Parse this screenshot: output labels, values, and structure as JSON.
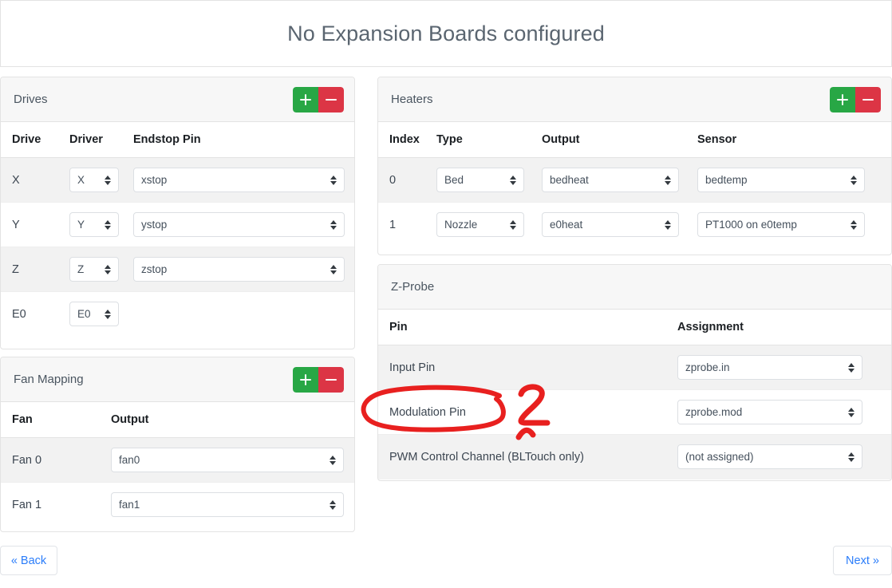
{
  "banner": {
    "title": "No Expansion Boards configured"
  },
  "colors": {
    "add": "#28a745",
    "remove": "#dc3545",
    "annotation": "#e8201f",
    "link": "#2b7dfa",
    "header_text": "#5a6570"
  },
  "drives_card": {
    "title": "Drives",
    "add_label": "+",
    "remove_label": "−",
    "columns": [
      "Drive",
      "Driver",
      "Endstop Pin"
    ],
    "rows": [
      {
        "drive": "X",
        "driver": "X",
        "endstop": "xstop"
      },
      {
        "drive": "Y",
        "driver": "Y",
        "endstop": "ystop"
      },
      {
        "drive": "Z",
        "driver": "Z",
        "endstop": "zstop"
      },
      {
        "drive": "E0",
        "driver": "E0",
        "endstop": ""
      }
    ]
  },
  "fan_card": {
    "title": "Fan Mapping",
    "add_label": "+",
    "remove_label": "−",
    "columns": [
      "Fan",
      "Output"
    ],
    "rows": [
      {
        "fan": "Fan 0",
        "output": "fan0"
      },
      {
        "fan": "Fan 1",
        "output": "fan1"
      }
    ]
  },
  "heaters_card": {
    "title": "Heaters",
    "add_label": "+",
    "remove_label": "−",
    "columns": [
      "Index",
      "Type",
      "Output",
      "Sensor"
    ],
    "rows": [
      {
        "index": "0",
        "type": "Bed",
        "output": "bedheat",
        "sensor": "bedtemp"
      },
      {
        "index": "1",
        "type": "Nozzle",
        "output": "e0heat",
        "sensor": "PT1000 on e0temp"
      }
    ]
  },
  "zprobe_card": {
    "title": "Z-Probe",
    "columns": [
      "Pin",
      "Assignment"
    ],
    "rows": [
      {
        "pin": "Input Pin",
        "assignment": "zprobe.in"
      },
      {
        "pin": "Modulation Pin",
        "assignment": "zprobe.mod"
      },
      {
        "pin": "PWM Control Channel (BLTouch only)",
        "assignment": "(not assigned)"
      }
    ]
  },
  "footer": {
    "back_label": "« Back",
    "next_label": "Next »"
  },
  "annotation": {
    "number": "2",
    "circled_item": "Modulation Pin"
  }
}
